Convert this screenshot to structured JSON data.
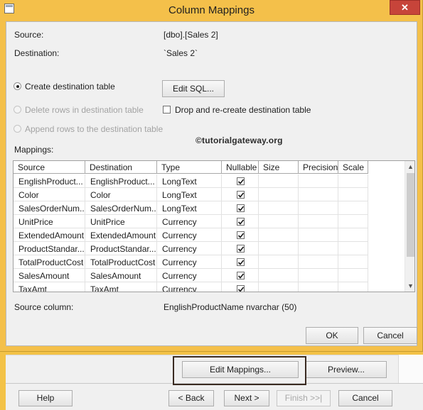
{
  "dialog": {
    "title": "Column Mappings",
    "close_glyph": "✕",
    "source_label": "Source:",
    "source_value": "[dbo].[Sales 2]",
    "destination_label": "Destination:",
    "destination_value": "`Sales 2`",
    "options": {
      "create_destination_table": "Create destination table",
      "delete_rows": "Delete rows in destination table",
      "append_rows": "Append rows to the destination table",
      "drop_recreate": "Drop and re-create destination table",
      "edit_sql_button": "Edit SQL..."
    },
    "watermark": "©tutorialgateway.org",
    "mappings_label": "Mappings:",
    "columns": [
      "Source",
      "Destination",
      "Type",
      "Nullable",
      "Size",
      "Precision",
      "Scale"
    ],
    "rows": [
      {
        "source": "EnglishProduct...",
        "destination": "EnglishProduct...",
        "type": "LongText",
        "nullable": true
      },
      {
        "source": "Color",
        "destination": "Color",
        "type": "LongText",
        "nullable": true
      },
      {
        "source": "SalesOrderNum...",
        "destination": "SalesOrderNum...",
        "type": "LongText",
        "nullable": true
      },
      {
        "source": "UnitPrice",
        "destination": "UnitPrice",
        "type": "Currency",
        "nullable": true
      },
      {
        "source": "ExtendedAmount",
        "destination": "ExtendedAmount",
        "type": "Currency",
        "nullable": true
      },
      {
        "source": "ProductStandar...",
        "destination": "ProductStandar...",
        "type": "Currency",
        "nullable": true
      },
      {
        "source": "TotalProductCost",
        "destination": "TotalProductCost",
        "type": "Currency",
        "nullable": true
      },
      {
        "source": "SalesAmount",
        "destination": "SalesAmount",
        "type": "Currency",
        "nullable": true
      },
      {
        "source": "TaxAmt",
        "destination": "TaxAmt",
        "type": "Currency",
        "nullable": true
      }
    ],
    "source_column_label": "Source column:",
    "source_column_value": "EnglishProductName nvarchar (50)",
    "ok_button": "OK",
    "cancel_button": "Cancel"
  },
  "wizard": {
    "edit_mappings_button": "Edit Mappings...",
    "preview_button": "Preview...",
    "help_button": "Help",
    "back_button": "< Back",
    "next_button": "Next >",
    "finish_button": "Finish >>|",
    "cancel_button": "Cancel"
  },
  "colors": {
    "title_bar": "#f4c04a",
    "close_button": "#c7443a",
    "dialog_background": "#f0f0f0",
    "highlight_border": "#3a2b22"
  }
}
